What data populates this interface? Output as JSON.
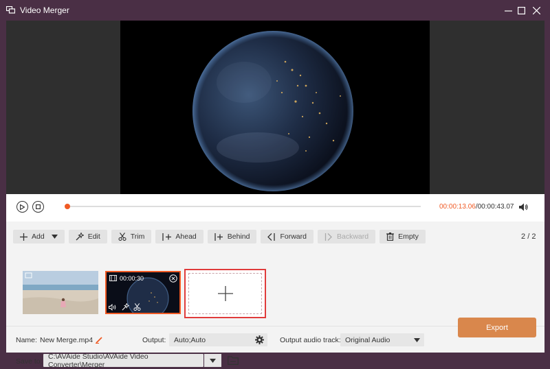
{
  "window": {
    "title": "Video Merger",
    "minimize_icon": "minimize-icon",
    "maximize_icon": "maximize-icon",
    "close_icon": "close-icon"
  },
  "player": {
    "current_time": "00:00:13.06",
    "separator": "/",
    "total_time": "00:00:43.07",
    "progress": 0.0
  },
  "toolbar": {
    "add": "Add",
    "edit": "Edit",
    "trim": "Trim",
    "ahead": "Ahead",
    "behind": "Behind",
    "forward": "Forward",
    "backward": "Backward",
    "empty": "Empty"
  },
  "clip_count": {
    "current": "2",
    "sep": "/",
    "total": "2"
  },
  "clips": [
    {
      "type": "beach"
    },
    {
      "type": "earth",
      "duration": "00:00:30"
    }
  ],
  "bottom": {
    "name_label": "Name:",
    "name_value": "New Merge.mp4",
    "output_label": "Output:",
    "output_value": "Auto;Auto",
    "audio_label": "Output audio track:",
    "audio_value": "Original Audio",
    "save_label": "Save to:",
    "save_value": "C:\\AVAide Studio\\AVAide Video Converter\\Merger",
    "export_label": "Export"
  },
  "colors": {
    "accent": "#f05a24",
    "titlebar": "#4a2f45",
    "export": "#d9874c",
    "add_slot_border": "#e03a3a"
  }
}
